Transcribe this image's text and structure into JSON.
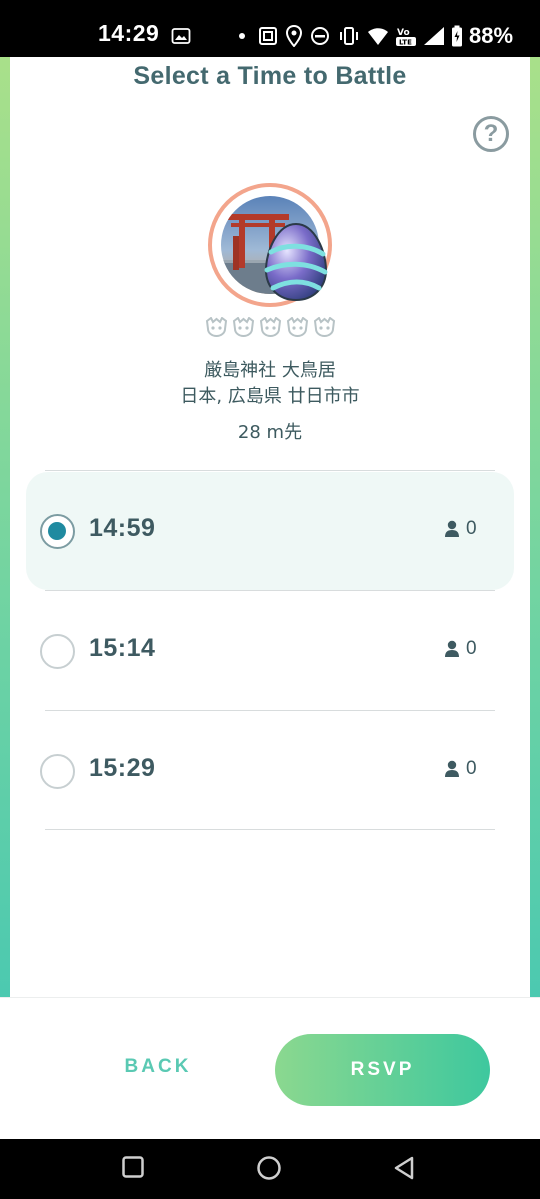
{
  "status_bar": {
    "time": "14:29",
    "battery": "88%"
  },
  "header": {
    "title": "Select a Time to Battle",
    "help_label": "?"
  },
  "gym": {
    "name": "厳島神社 大鳥居",
    "location": "日本, 広島県 廿日市市",
    "distance": "28 m先",
    "tier_count": 5
  },
  "slots": [
    {
      "time": "14:59",
      "count": "0",
      "selected": true
    },
    {
      "time": "15:14",
      "count": "0",
      "selected": false
    },
    {
      "time": "15:29",
      "count": "0",
      "selected": false
    }
  ],
  "actions": {
    "back_label": "BACK",
    "rsvp_label": "RSVP"
  },
  "colors": {
    "accent": "#1f8aa0",
    "title_text": "#44696f",
    "back_text": "#5ac9b3",
    "rsvp_gradient_start": "#8bd88f",
    "rsvp_gradient_end": "#3ec89e",
    "ring": "#f3a58c"
  },
  "icons": {
    "help": "question-circle-icon",
    "person": "person-icon",
    "tier": "raid-boss-head-icon"
  }
}
